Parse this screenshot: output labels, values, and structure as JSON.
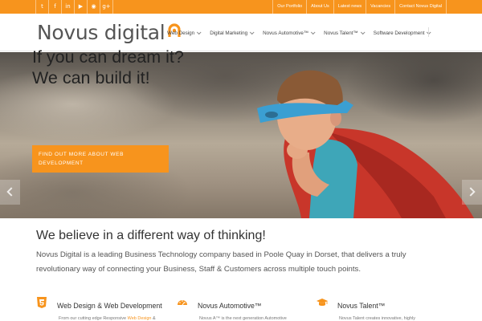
{
  "colors": {
    "accent": "#f7941d",
    "text": "#333333"
  },
  "topbar": {
    "social": [
      {
        "name": "twitter-icon",
        "glyph": "t"
      },
      {
        "name": "facebook-icon",
        "glyph": "f"
      },
      {
        "name": "linkedin-icon",
        "glyph": "in"
      },
      {
        "name": "youtube-icon",
        "glyph": "▶"
      },
      {
        "name": "rss-icon",
        "glyph": "◉"
      },
      {
        "name": "googleplus-icon",
        "glyph": "g+"
      }
    ],
    "links": [
      "Our Portfolio",
      "About Us",
      "Latest news",
      "Vacancies",
      "Contact Novus Digital"
    ]
  },
  "header": {
    "logo_text": "Novus digital",
    "nav": [
      "Web Design",
      "Digital Marketing",
      "Novus Automotive™",
      "Novus Talent™",
      "Software Development"
    ]
  },
  "hero": {
    "title": "If you can dream it?\nWe can build it!",
    "cta": "FIND OUT MORE ABOUT WEB DEVELOPMENT"
  },
  "content": {
    "headline": "We believe in a different way of thinking!",
    "intro": "Novus Digital is a leading Business Technology company based in Poole Quay in Dorset, that delivers a truly revolutionary way of connecting your Business, Staff & Customers across multiple touch points."
  },
  "features": [
    {
      "icon": "html5-icon",
      "title": "Web Design & Web Development",
      "desc_prefix": "From our cutting edge Responsive ",
      "desc_link": "Web Design",
      "desc_suffix": " &"
    },
    {
      "icon": "speedometer-icon",
      "title": "Novus Automotive™",
      "desc_prefix": "Novus A™ is the next generation Automotive",
      "desc_link": "",
      "desc_suffix": ""
    },
    {
      "icon": "graduation-cap-icon",
      "title": "Novus Talent™",
      "desc_prefix": "Novus Talent creates innovative, highly",
      "desc_link": "",
      "desc_suffix": ""
    }
  ]
}
